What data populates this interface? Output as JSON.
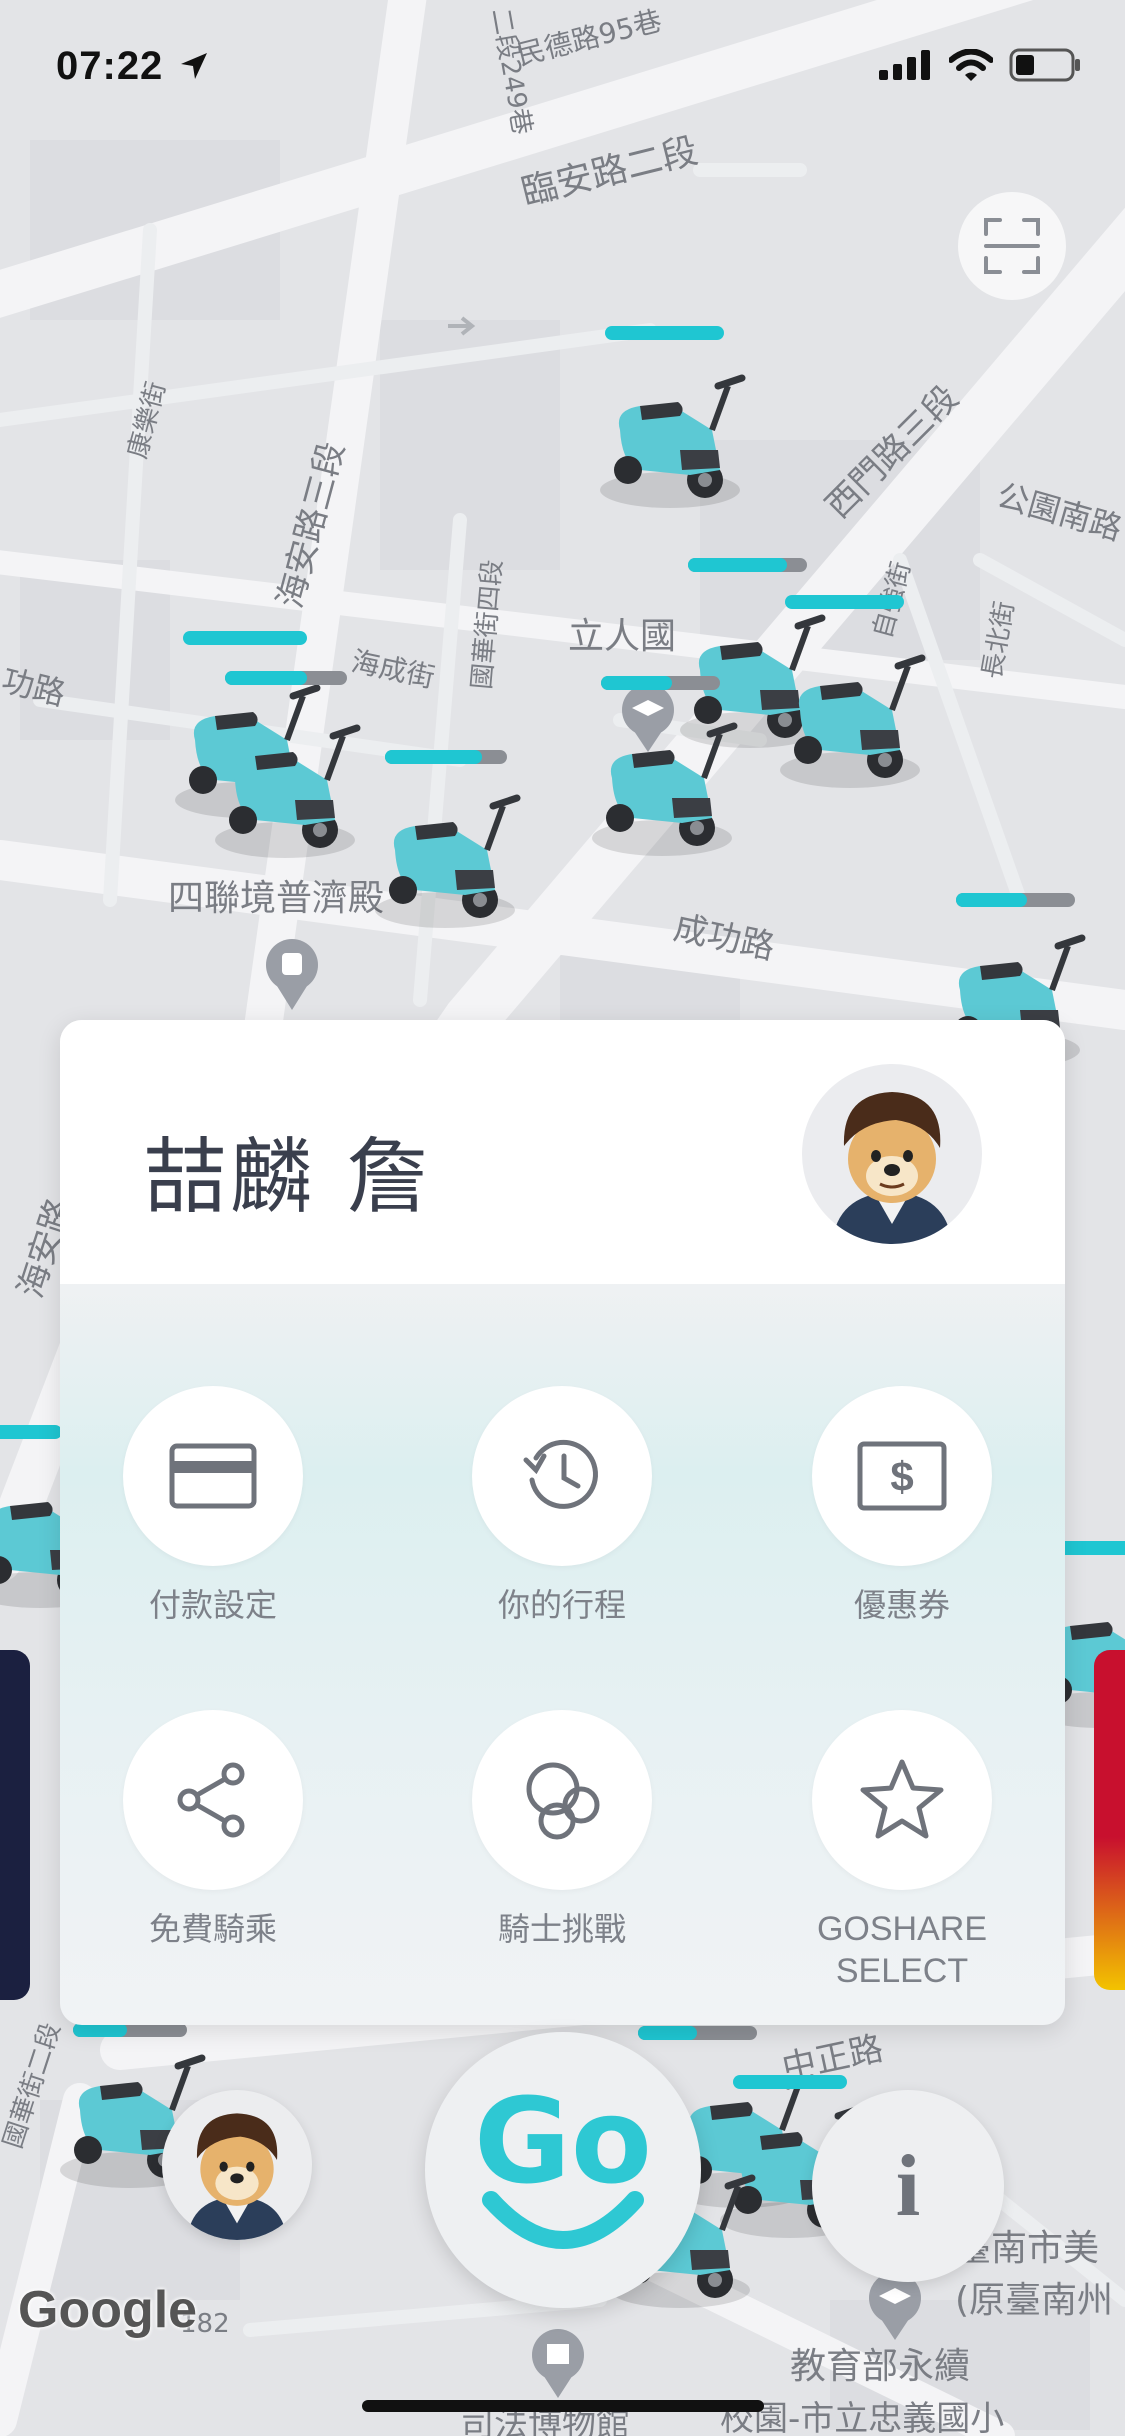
{
  "status_bar": {
    "time": "07:22"
  },
  "map": {
    "labels": {
      "road_1": "臨安路二段",
      "road_2": "民德路95巷",
      "road_3": "二段249巷",
      "road_4": "康樂街",
      "road_5": "海安路三段",
      "road_6": "西門路三段",
      "road_7": "公園南路",
      "road_8": "國華街四段",
      "road_9": "海成街",
      "road_10": "立人國",
      "road_11": "自強街",
      "road_12": "長北街",
      "road_13": "功路",
      "temple": "四聯境普濟殿",
      "road_14": "成功路",
      "road_15": "海安路",
      "road_16": "中正路",
      "place_1": "臺南市美",
      "place_2": "(原臺南州",
      "place_3": "教育部永續",
      "place_4": "校園-市立忠義國小",
      "place_5": "司法博物館",
      "road_17": "國華街二段",
      "road_18": "182"
    },
    "attribution": "Google"
  },
  "profile": {
    "name": "喆麟 詹"
  },
  "menu": [
    {
      "label": "付款設定",
      "icon": "credit-card-icon"
    },
    {
      "label": "你的行程",
      "icon": "history-icon"
    },
    {
      "label": "優惠券",
      "icon": "coupon-icon"
    },
    {
      "label": "免費騎乘",
      "icon": "share-icon"
    },
    {
      "label": "騎士挑戰",
      "icon": "bubbles-icon"
    },
    {
      "label_line1": "GOSHARE",
      "label_line2": "SELECT",
      "icon": "star-icon"
    }
  ],
  "go_button": {
    "text": "Go"
  },
  "info_button": {
    "text": "i"
  },
  "colors": {
    "accent": "#2ec8d3",
    "scooter": "#5cc9d4",
    "text_dark": "#3a3f4d",
    "text_muted": "#7d8189"
  }
}
